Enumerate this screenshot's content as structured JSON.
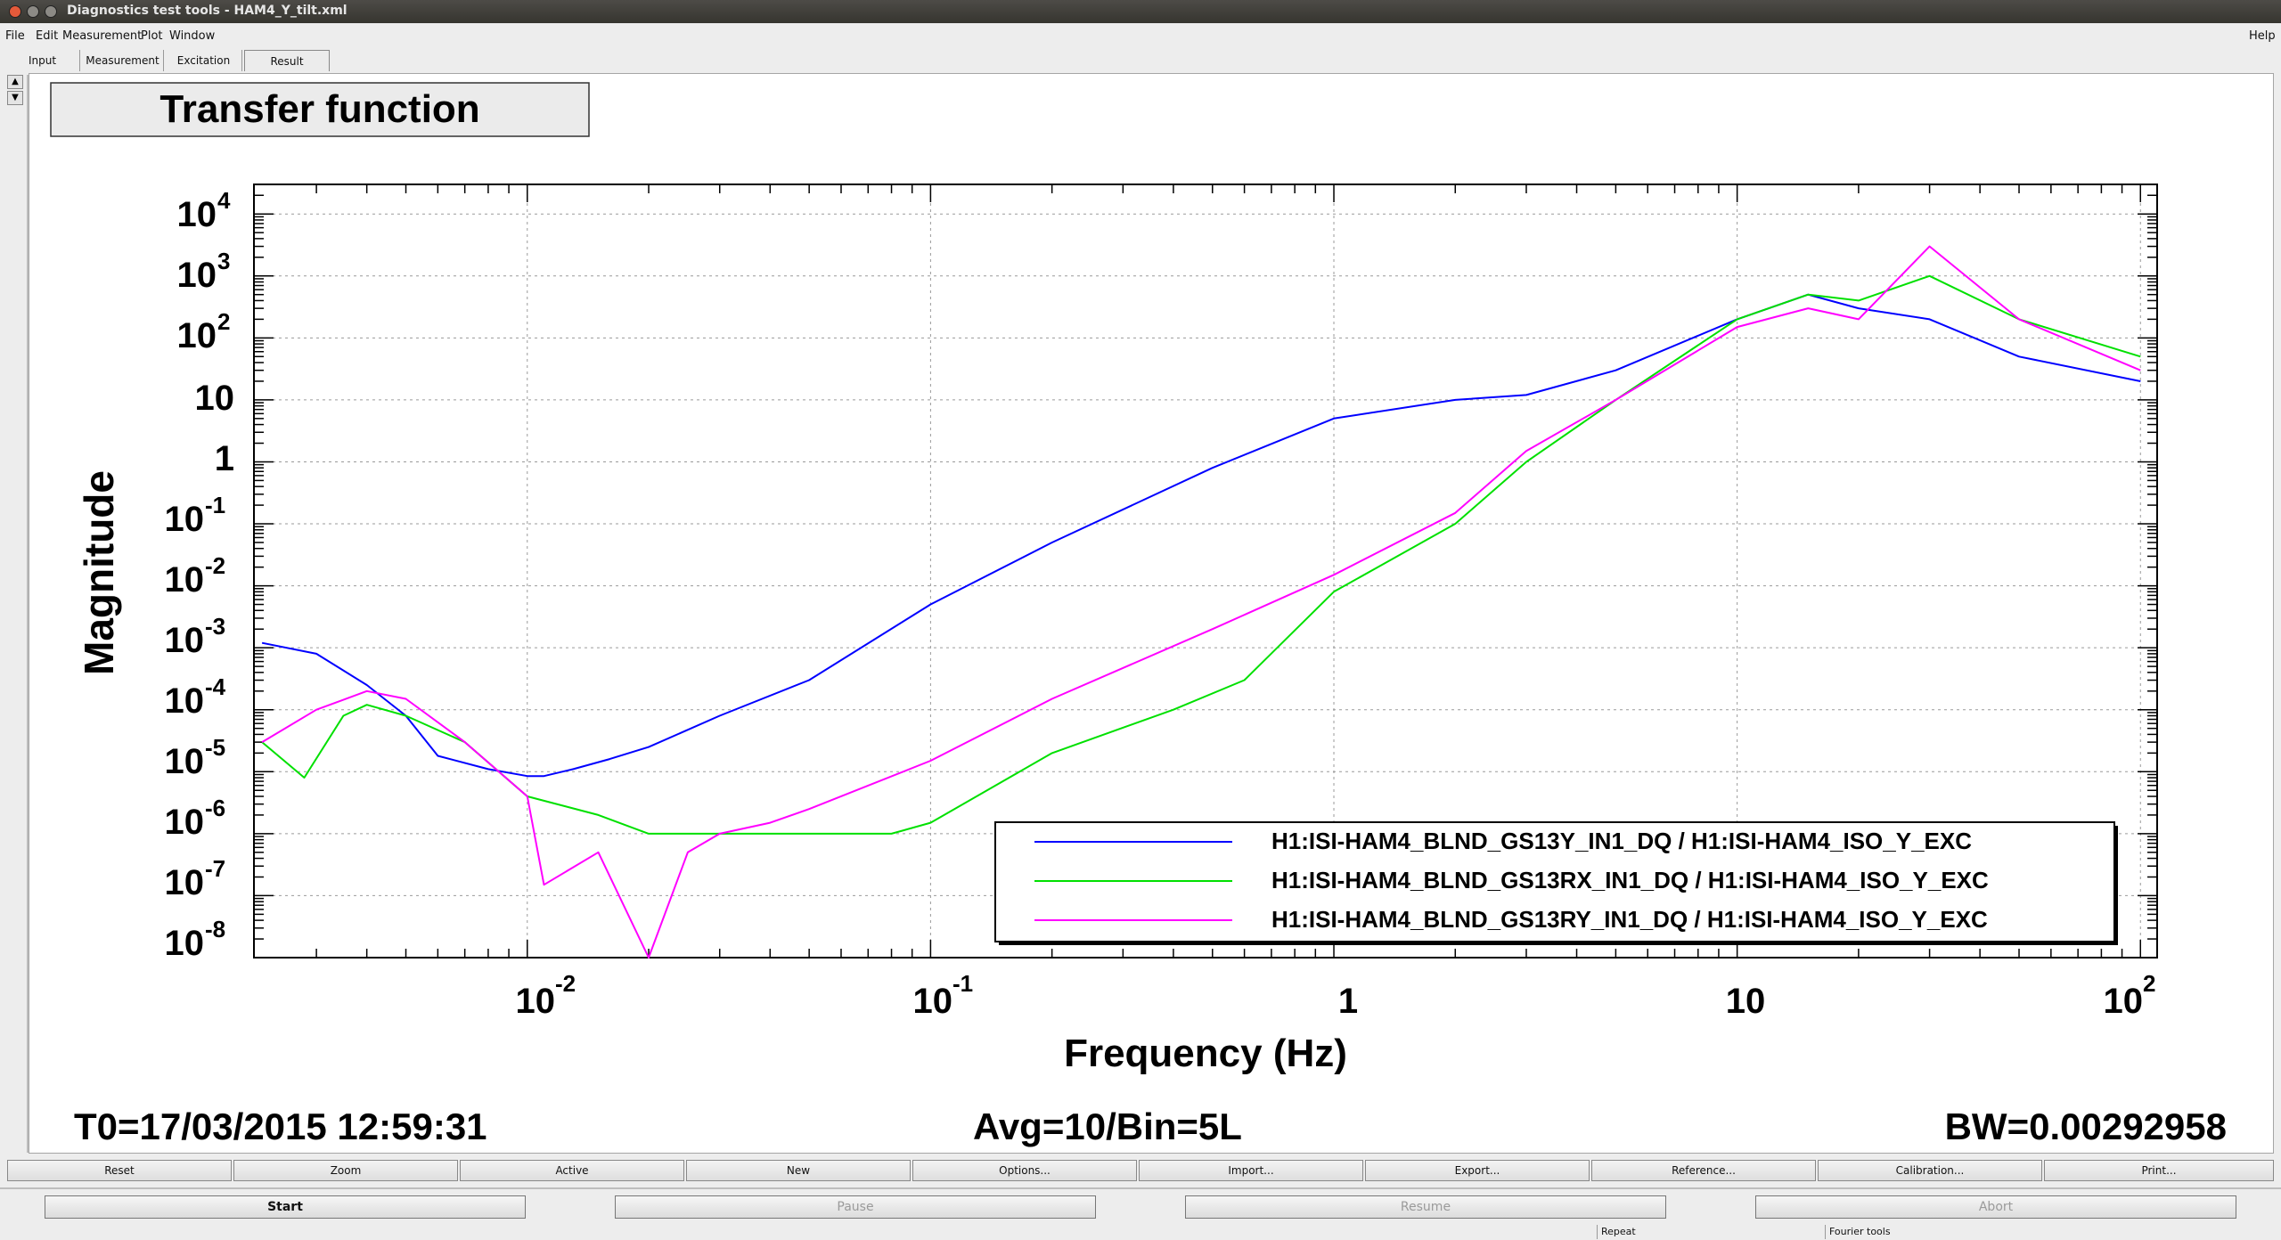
{
  "window": {
    "title": "Diagnostics test tools - HAM4_Y_tilt.xml"
  },
  "menu": {
    "file": "File",
    "edit": "Edit",
    "measurement": "Measurement",
    "plot": "Plot",
    "window": "Window",
    "help": "Help"
  },
  "tabs": [
    {
      "label": "Input"
    },
    {
      "label": "Measurement"
    },
    {
      "label": "Excitation"
    },
    {
      "label": "Result"
    }
  ],
  "side": {
    "up": "▲",
    "down": "▼"
  },
  "plot": {
    "title": "Transfer function",
    "xlabel": "Frequency (Hz)",
    "ylabel": "Magnitude",
    "xtick_labels": [
      "10",
      "-2",
      "10",
      "-1",
      "1",
      "10",
      "10",
      "2"
    ],
    "ytick_labels": [
      "10",
      "4",
      "10",
      "3",
      "10",
      "2",
      "10",
      "1",
      "10",
      "-1",
      "10",
      "-2",
      "10",
      "-3",
      "10",
      "-4",
      "10",
      "-5",
      "10",
      "-6",
      "10",
      "-7",
      "10",
      "-8"
    ],
    "footer_left": "T0=17/03/2015 12:59:31",
    "footer_center": "Avg=10/Bin=5L",
    "footer_right": "BW=0.00292958"
  },
  "chart_data": {
    "type": "line",
    "title": "Transfer function",
    "xlabel": "Frequency (Hz)",
    "ylabel": "Magnitude",
    "xscale": "log",
    "yscale": "log",
    "xlim": [
      0.0021,
      110
    ],
    "ylim": [
      1e-08,
      30000
    ],
    "grid": true,
    "legend_position": "bottom-right",
    "series": [
      {
        "name": "H1:ISI-HAM4_BLND_GS13Y_IN1_DQ / H1:ISI-HAM4_ISO_Y_EXC",
        "color": "#0000ff",
        "x": [
          0.0022,
          0.003,
          0.004,
          0.005,
          0.006,
          0.008,
          0.01,
          0.011,
          0.013,
          0.016,
          0.02,
          0.03,
          0.05,
          0.1,
          0.2,
          0.5,
          1,
          2,
          3,
          5,
          10,
          15,
          20,
          30,
          50,
          100
        ],
        "y": [
          0.0012,
          0.0008,
          0.00025,
          8e-05,
          1.8e-05,
          1.1e-05,
          8.5e-06,
          8.5e-06,
          1.1e-05,
          1.6e-05,
          2.5e-05,
          8e-05,
          0.0003,
          0.005,
          0.05,
          0.8,
          5,
          10,
          12,
          30,
          200,
          500,
          300,
          200,
          50,
          20
        ]
      },
      {
        "name": "H1:ISI-HAM4_BLND_GS13RX_IN1_DQ / H1:ISI-HAM4_ISO_Y_EXC",
        "color": "#00e000",
        "x": [
          0.0022,
          0.0028,
          0.0035,
          0.004,
          0.005,
          0.007,
          0.01,
          0.015,
          0.02,
          0.03,
          0.05,
          0.08,
          0.1,
          0.2,
          0.4,
          0.6,
          1,
          2,
          3,
          5,
          10,
          15,
          20,
          30,
          50,
          100
        ],
        "y": [
          3e-05,
          8e-06,
          8e-05,
          0.00012,
          8e-05,
          3e-05,
          4e-06,
          2e-06,
          1e-06,
          1e-06,
          1e-06,
          1e-06,
          1.5e-06,
          2e-05,
          0.0001,
          0.0003,
          0.008,
          0.1,
          1,
          10,
          200,
          500,
          400,
          1000,
          200,
          50
        ]
      },
      {
        "name": "H1:ISI-HAM4_BLND_GS13RY_IN1_DQ / H1:ISI-HAM4_ISO_Y_EXC",
        "color": "#ff00ff",
        "x": [
          0.0022,
          0.003,
          0.004,
          0.005,
          0.007,
          0.01,
          0.011,
          0.015,
          0.02,
          0.025,
          0.03,
          0.04,
          0.05,
          0.1,
          0.2,
          0.5,
          1,
          2,
          3,
          5,
          10,
          15,
          20,
          30,
          50,
          100
        ],
        "y": [
          3e-05,
          0.0001,
          0.0002,
          0.00015,
          3e-05,
          4e-06,
          1.5e-07,
          5e-07,
          1e-08,
          5e-07,
          1e-06,
          1.5e-06,
          2.5e-06,
          1.5e-05,
          0.00015,
          0.002,
          0.015,
          0.15,
          1.5,
          10,
          150,
          300,
          200,
          3000,
          200,
          30
        ]
      }
    ]
  },
  "buttons": {
    "reset": "Reset",
    "zoom": "Zoom",
    "active": "Active",
    "new": "New",
    "options": "Options...",
    "import": "Import...",
    "export": "Export...",
    "reference": "Reference...",
    "calibration": "Calibration...",
    "print": "Print..."
  },
  "run_buttons": {
    "start": "Start",
    "pause": "Pause",
    "resume": "Resume",
    "abort": "Abort"
  },
  "status": {
    "repeat": "Repeat",
    "fourier": "Fourier tools"
  }
}
